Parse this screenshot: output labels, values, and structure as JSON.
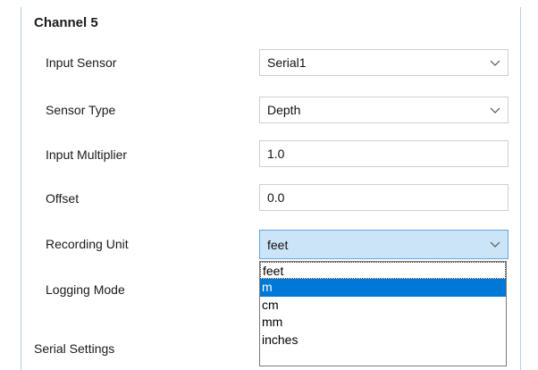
{
  "panel": {
    "title": "Channel 5"
  },
  "form": {
    "input_sensor": {
      "label": "Input Sensor",
      "value": "Serial1",
      "icon": "chevron-down-icon"
    },
    "sensor_type": {
      "label": "Sensor Type",
      "value": "Depth",
      "icon": "chevron-down-icon"
    },
    "input_multiplier": {
      "label": "Input Multiplier",
      "value": "1.0"
    },
    "offset": {
      "label": "Offset",
      "value": "0.0"
    },
    "recording_unit": {
      "label": "Recording Unit",
      "value": "feet",
      "icon": "chevron-down-icon",
      "options": [
        "feet",
        "m",
        "cm",
        "mm",
        "inches"
      ],
      "highlighted": "m"
    },
    "logging_mode": {
      "label": "Logging Mode"
    }
  },
  "section": {
    "serial_settings": "Serial Settings"
  },
  "colors": {
    "highlight": "#0078d7",
    "active_field": "#cce4f7",
    "frame_border": "#b9cde8"
  }
}
